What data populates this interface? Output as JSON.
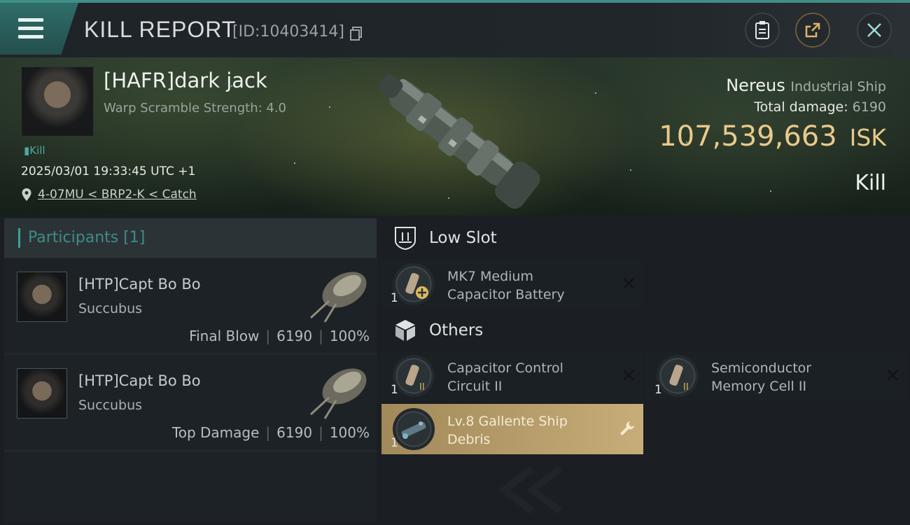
{
  "header": {
    "title": "KILL REPORT",
    "report_id": "[ID:10403414]"
  },
  "victim": {
    "name": "[HAFR]dark jack",
    "warp_scramble": "Warp Scramble Strength: 4.0",
    "kill_tag": "Kill",
    "datetime": "2025/03/01 19:33:45 UTC +1",
    "location": "4-07MU < BRP2-K < Catch",
    "ship": "Nereus",
    "ship_class": "Industrial Ship",
    "total_damage_label": "Total damage:",
    "total_damage": "6190",
    "isk_value": "107,539,663",
    "isk_unit": "ISK",
    "result": "Kill"
  },
  "participants": {
    "header": "Participants [1]",
    "rows": [
      {
        "name": "[HTP]Capt Bo Bo",
        "ship": "Succubus",
        "role": "Final Blow",
        "damage": "6190",
        "percent": "100%"
      },
      {
        "name": "[HTP]Capt Bo Bo",
        "ship": "Succubus",
        "role": "Top Damage",
        "damage": "6190",
        "percent": "100%"
      }
    ]
  },
  "sections": {
    "low_slot": {
      "title": "Low Slot",
      "items": [
        {
          "qty": "1",
          "name_line1": "MK7 Medium",
          "name_line2": "Capacitor Battery",
          "icon": "capacitor-battery-icon"
        }
      ]
    },
    "others": {
      "title": "Others",
      "items": [
        {
          "qty": "1",
          "name_line1": "Capacitor Control",
          "name_line2": "Circuit II",
          "icon": "capacitor-circuit-icon"
        },
        {
          "qty": "1",
          "name_line1": "Semiconductor",
          "name_line2": "Memory Cell II",
          "icon": "memory-cell-icon"
        },
        {
          "qty": "1",
          "name_line1": "Lv.8 Gallente Ship",
          "name_line2": "Debris",
          "icon": "ship-debris-icon"
        }
      ]
    }
  },
  "colors": {
    "accent_teal": "#3aa39a",
    "isk_gold": "#e9c98a",
    "highlight_item": "#c7ad78"
  }
}
